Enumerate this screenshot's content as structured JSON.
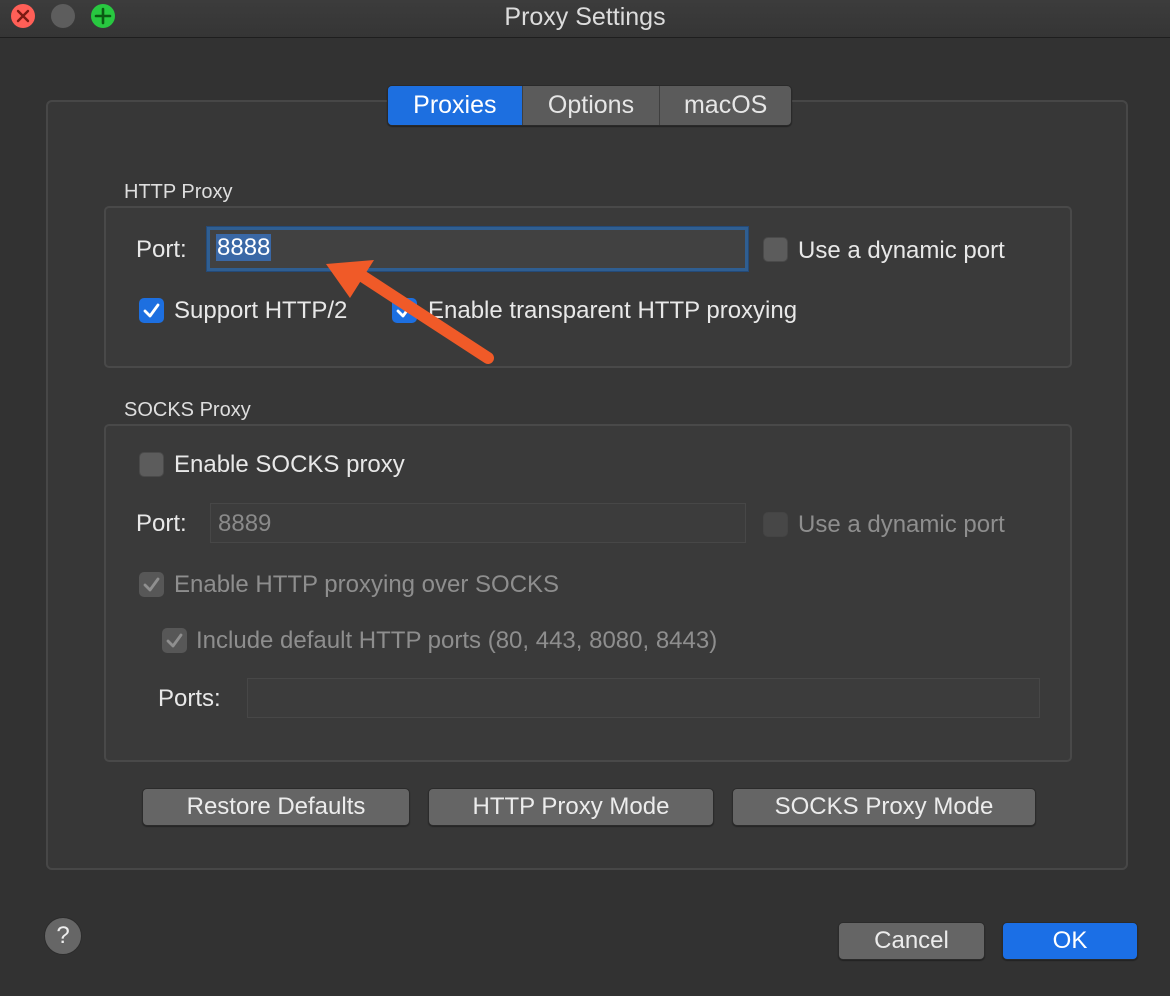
{
  "window": {
    "title": "Proxy Settings"
  },
  "tabs": [
    {
      "label": "Proxies",
      "active": true
    },
    {
      "label": "Options",
      "active": false
    },
    {
      "label": "macOS",
      "active": false
    }
  ],
  "http_proxy": {
    "group_label": "HTTP Proxy",
    "port_label": "Port:",
    "port_value": "8888",
    "dynamic_port_label": "Use a dynamic port",
    "dynamic_port_checked": false,
    "support_http2_label": "Support HTTP/2",
    "support_http2_checked": true,
    "transparent_label": "Enable transparent HTTP proxying",
    "transparent_checked": true
  },
  "socks_proxy": {
    "group_label": "SOCKS Proxy",
    "enable_label": "Enable SOCKS proxy",
    "enable_checked": false,
    "port_label": "Port:",
    "port_value": "8889",
    "dynamic_port_label": "Use a dynamic port",
    "http_over_socks_label": "Enable HTTP proxying over SOCKS",
    "include_default_label": "Include default HTTP ports (80, 443, 8080, 8443)",
    "ports_label": "Ports:",
    "ports_value": ""
  },
  "actions": {
    "restore_defaults": "Restore Defaults",
    "http_proxy_mode": "HTTP Proxy Mode",
    "socks_proxy_mode": "SOCKS Proxy Mode"
  },
  "footer": {
    "help": "?",
    "cancel": "Cancel",
    "ok": "OK"
  },
  "colors": {
    "accent": "#1d6fe0",
    "annotation_arrow": "#f05a28"
  }
}
